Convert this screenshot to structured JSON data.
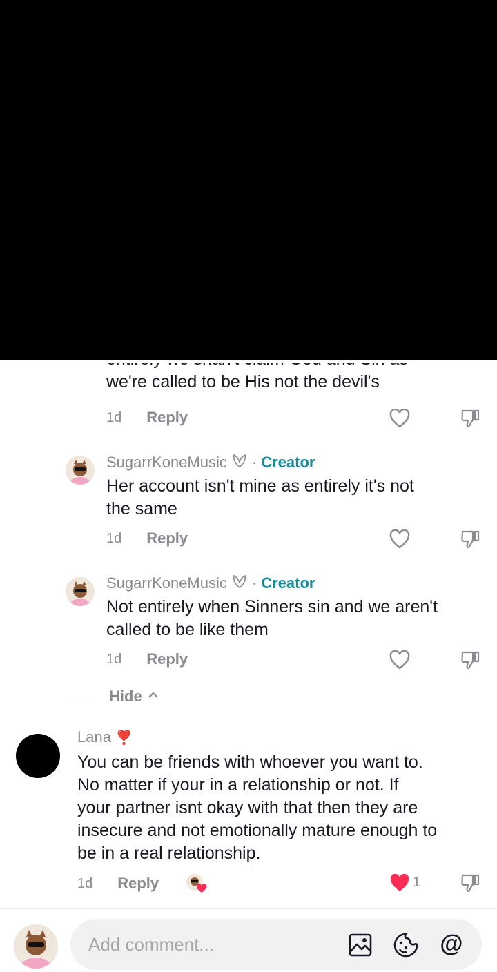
{
  "partial_comment": {
    "line1": "entirely we shan't claim God and Sin as",
    "line2": "we're called to be His not the devil's",
    "time": "1d",
    "reply_label": "Reply"
  },
  "replies": [
    {
      "username": "SugarrKoneMusic",
      "badge": "Creator",
      "separator": "·",
      "line1": "Her account isn't mine as entirely it's not",
      "line2": "the same",
      "time": "1d",
      "reply_label": "Reply"
    },
    {
      "username": "SugarrKoneMusic",
      "badge": "Creator",
      "separator": "·",
      "line1": "Not entirely when Sinners sin and we aren't",
      "line2": "called to be like them",
      "time": "1d",
      "reply_label": "Reply"
    }
  ],
  "hide": {
    "label": "Hide",
    "icon": "chevron-up-icon"
  },
  "comment": {
    "username": "Lana",
    "emoji": "❣️",
    "lines": [
      "You can be friends with whoever you want to.",
      "No matter if your in a relationship or not. If",
      "your partner isnt okay with that then they are",
      "insecure and not emotionally mature enough to",
      "be in a real relationship."
    ],
    "time": "1d",
    "reply_label": "Reply",
    "like_count": "1",
    "liked": true
  },
  "composer": {
    "placeholder": "Add comment...",
    "icons": [
      "image-icon",
      "emoji-icon",
      "mention-icon"
    ],
    "mention_glyph": "@"
  },
  "colors": {
    "creator": "#178e9e",
    "like": "#fe2c55",
    "muted": "#8a8b91"
  }
}
